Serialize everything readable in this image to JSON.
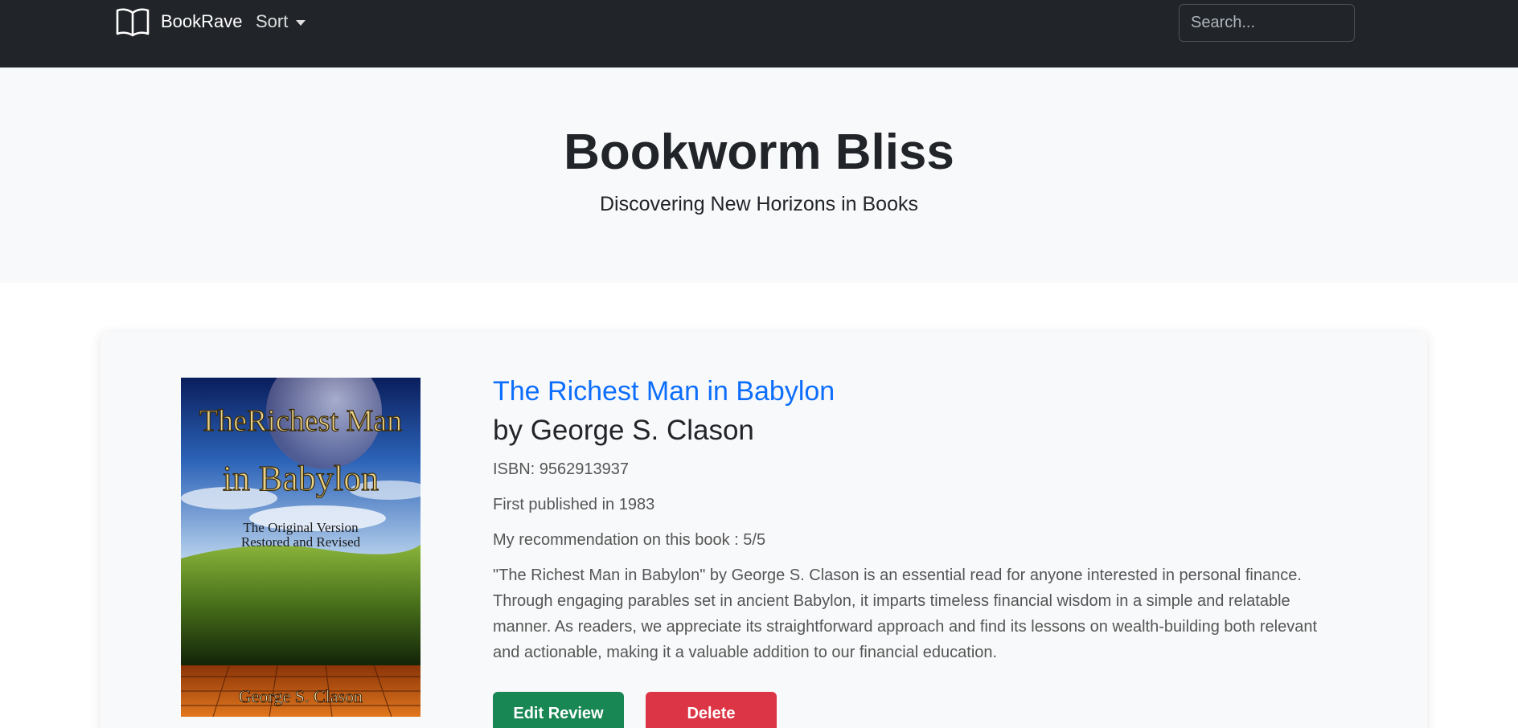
{
  "navbar": {
    "brand": "BookRave",
    "sort_label": "Sort",
    "search_placeholder": "Search..."
  },
  "hero": {
    "title": "Bookworm Bliss",
    "subtitle": "Discovering New Horizons in Books"
  },
  "book": {
    "title": "The Richest Man in Babylon",
    "author_line": "by George S. Clason",
    "isbn_line": "ISBN: 9562913937",
    "published_line": "First published in 1983",
    "recommendation_line": "My recommendation on this book : 5/5",
    "review": "\"The Richest Man in Babylon\" by George S. Clason is an essential read for anyone interested in personal finance. Through engaging parables set in ancient Babylon, it imparts timeless financial wisdom in a simple and relatable manner. As readers, we appreciate its straightforward approach and find its lessons on wealth-building both relevant and actionable, making it a valuable addition to our financial education.",
    "cover": {
      "title_line1": "TheRichest Man",
      "title_line2": "in Babylon",
      "tagline1": "The Original Version",
      "tagline2": "Restored and Revised",
      "author": "George S. Clason"
    }
  },
  "actions": {
    "edit_label": "Edit Review",
    "delete_label": "Delete"
  },
  "colors": {
    "navbar_bg": "#212529",
    "link": "#0d6efd",
    "edit": "#198754",
    "delete": "#dc3545"
  }
}
